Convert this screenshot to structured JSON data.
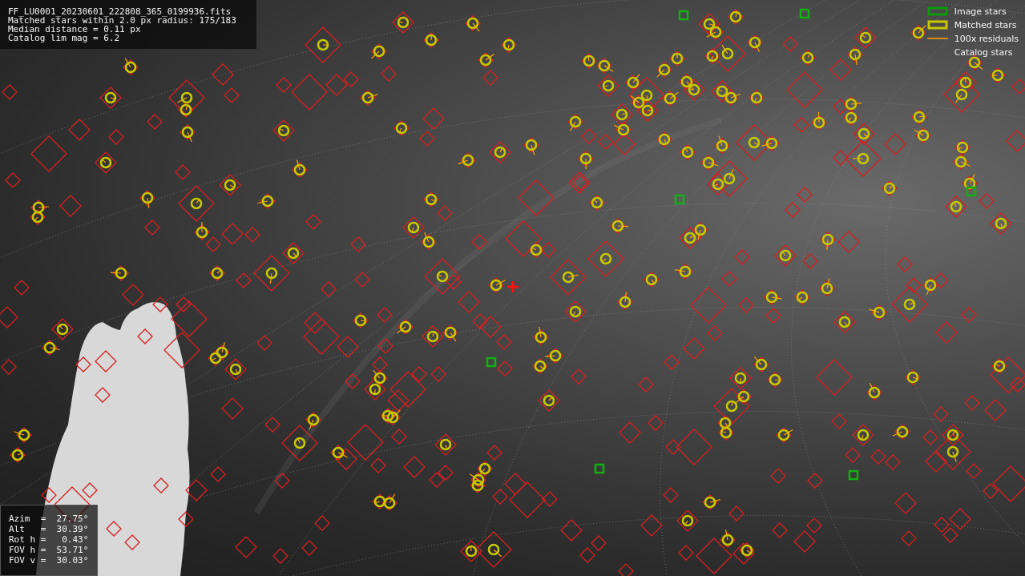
{
  "info_panel": {
    "lines": [
      "FF_LU0001_20230601_222808_365_0199936.fits",
      "Matched stars within 2.0 px radius: 175/183",
      "Median distance = 0.11 px",
      "Catalog lim mag = 6.2"
    ]
  },
  "legend": {
    "items": [
      {
        "label": "Image stars",
        "kind": "image"
      },
      {
        "label": "Matched stars",
        "kind": "matched"
      },
      {
        "label": "100x residuals",
        "kind": "residual"
      },
      {
        "label": "Catalog stars",
        "kind": "catalog"
      }
    ]
  },
  "pointing_panel": {
    "lines": [
      "Azim  =  27.75°",
      "Alt   =  30.39°",
      "Rot h =   0.43°",
      "FOV h =  53.71°",
      "FOV v =  30.03°"
    ]
  }
}
